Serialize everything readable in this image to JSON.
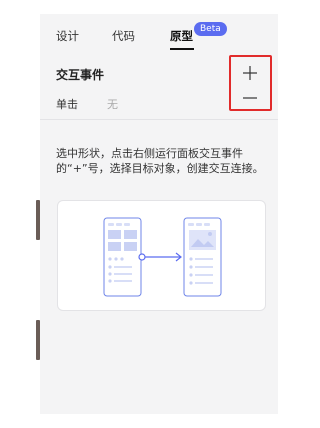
{
  "tabs": [
    {
      "label": "设计"
    },
    {
      "label": "代码"
    },
    {
      "label": "原型"
    }
  ],
  "beta_badge": "Beta",
  "interaction": {
    "title": "交互事件",
    "event_label": "单击",
    "event_value": "无"
  },
  "help_text": "选中形状，点击右侧运行面板交互事件的“+”号，选择目标对象，创建交互连接。",
  "colors": {
    "accent": "#5b6cf0",
    "highlight_border": "#e12b2b",
    "panel_bg": "#f4f4f5"
  },
  "icons": {
    "add": "plus-icon",
    "remove": "minus-icon"
  }
}
